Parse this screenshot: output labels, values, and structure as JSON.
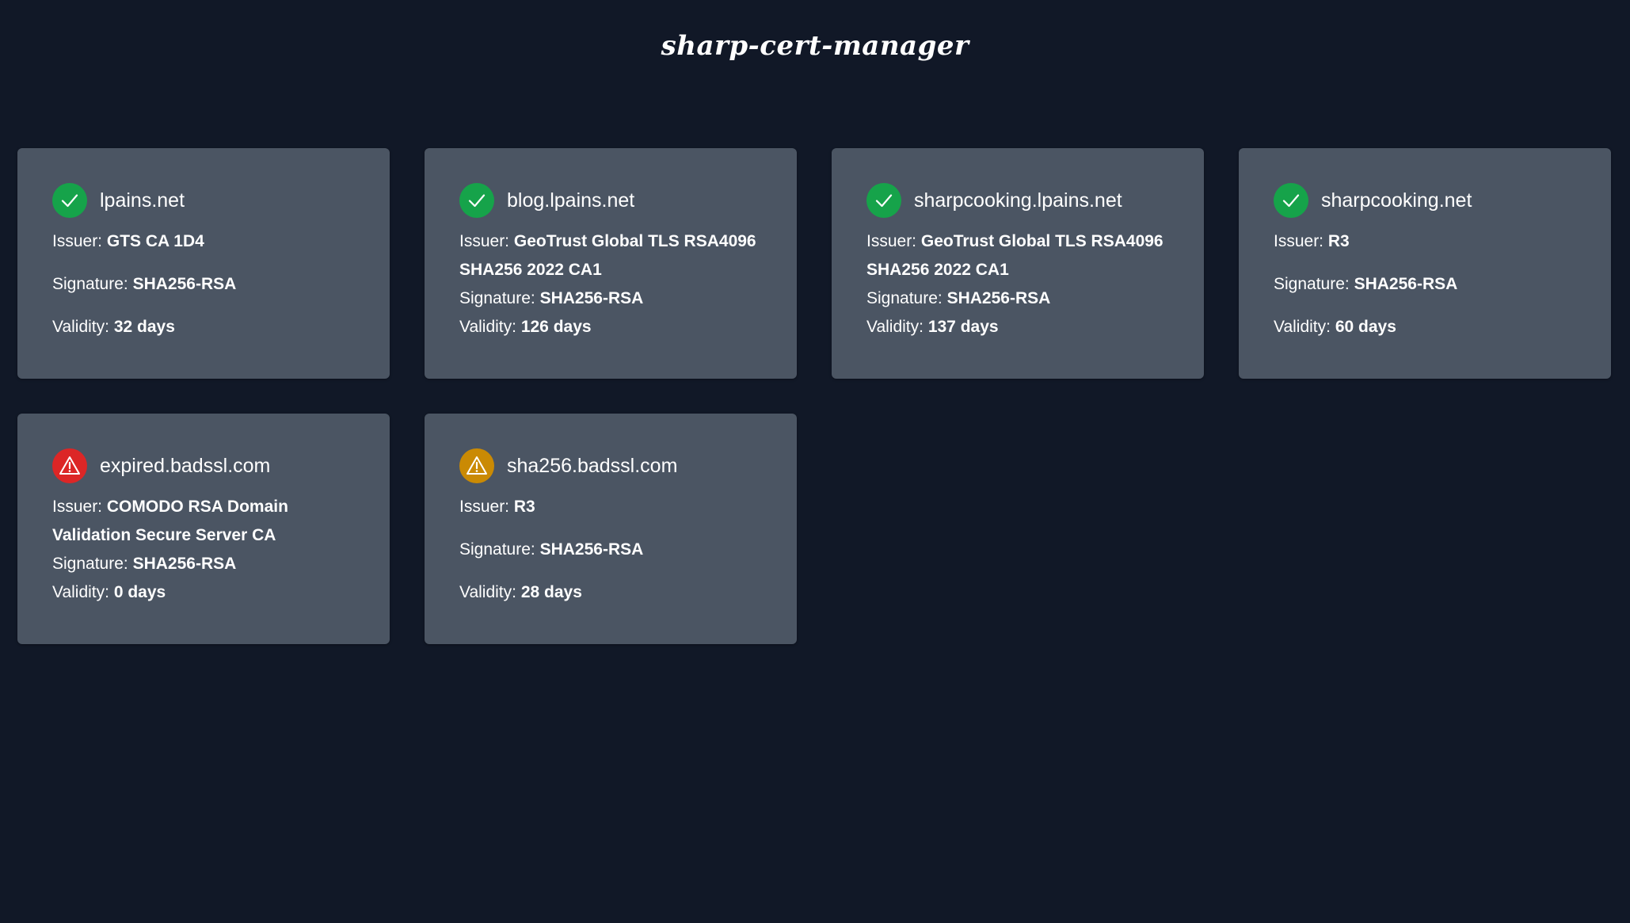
{
  "app": {
    "title": "sharp-cert-manager"
  },
  "labels": {
    "issuer": "Issuer:",
    "signature": "Signature:",
    "validity": "Validity:"
  },
  "colors": {
    "background": "#111827",
    "card": "#4b5563",
    "ok": "#16a34a",
    "error": "#dc2626",
    "warning": "#ca8a04"
  },
  "certificates": [
    {
      "domain": "lpains.net",
      "status": "ok",
      "icon": "check-circle-icon",
      "issuer": "GTS CA 1D4",
      "signature": "SHA256-RSA",
      "validity": "32 days"
    },
    {
      "domain": "blog.lpains.net",
      "status": "ok",
      "icon": "check-circle-icon",
      "issuer": "GeoTrust Global TLS RSA4096 SHA256 2022 CA1",
      "signature": "SHA256-RSA",
      "validity": "126 days"
    },
    {
      "domain": "sharpcooking.lpains.net",
      "status": "ok",
      "icon": "check-circle-icon",
      "issuer": "GeoTrust Global TLS RSA4096 SHA256 2022 CA1",
      "signature": "SHA256-RSA",
      "validity": "137 days"
    },
    {
      "domain": "sharpcooking.net",
      "status": "ok",
      "icon": "check-circle-icon",
      "issuer": "R3",
      "signature": "SHA256-RSA",
      "validity": "60 days"
    },
    {
      "domain": "expired.badssl.com",
      "status": "error",
      "icon": "warning-triangle-icon",
      "issuer": "COMODO RSA Domain Validation Secure Server CA",
      "signature": "SHA256-RSA",
      "validity": "0 days"
    },
    {
      "domain": "sha256.badssl.com",
      "status": "warning",
      "icon": "warning-triangle-icon",
      "issuer": "R3",
      "signature": "SHA256-RSA",
      "validity": "28 days"
    }
  ]
}
